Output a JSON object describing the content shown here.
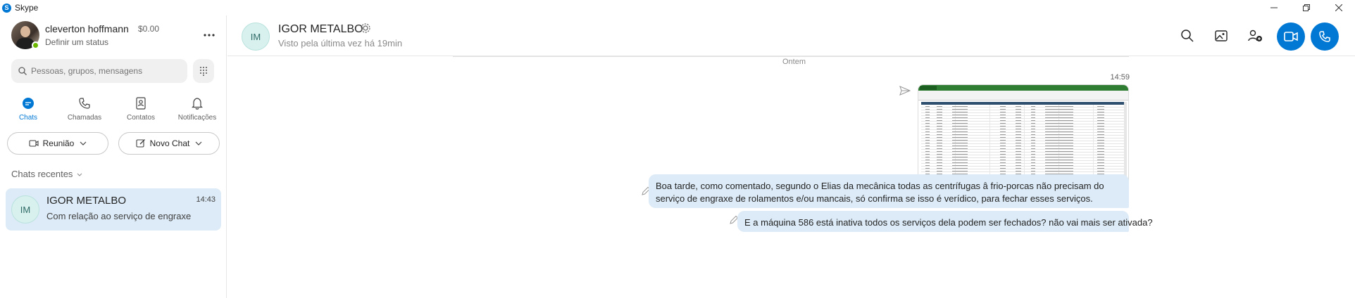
{
  "titlebar": {
    "app_name": "Skype",
    "logo_letter": "S"
  },
  "profile": {
    "name": "cleverton hoffmann",
    "credit": "$0.00",
    "status": "Definir um status"
  },
  "search": {
    "placeholder": "Pessoas, grupos, mensagens"
  },
  "nav": {
    "chats": "Chats",
    "calls": "Chamadas",
    "contacts": "Contatos",
    "notifications": "Notificações"
  },
  "actions": {
    "meeting": "Reunião",
    "new_chat": "Novo Chat"
  },
  "recent_chats_label": "Chats recentes",
  "chats": [
    {
      "initials": "IM",
      "name": "IGOR METALBO",
      "time": "14:43",
      "preview": "Com relação ao serviço de engraxe"
    }
  ],
  "conversation": {
    "initials": "IM",
    "name": "IGOR METALBO",
    "last_seen": "Visto pela última vez há 19min",
    "day_divider": "Ontem",
    "image_time": "14:59",
    "messages": [
      "Boa tarde, como comentado, segundo o Elias da mecânica todas as centrífugas â frio-porcas não precisam do serviço de engraxe de rolamentos e/ou mancais, só confirma se isso é verídico, para fechar esses serviços.",
      "E a máquina 586 está inativa todos os serviços dela podem ser fechados? não vai mais ser ativada?"
    ]
  },
  "colors": {
    "accent": "#0078d4",
    "bubble": "#dcebf7",
    "presence": "#6bb700"
  }
}
